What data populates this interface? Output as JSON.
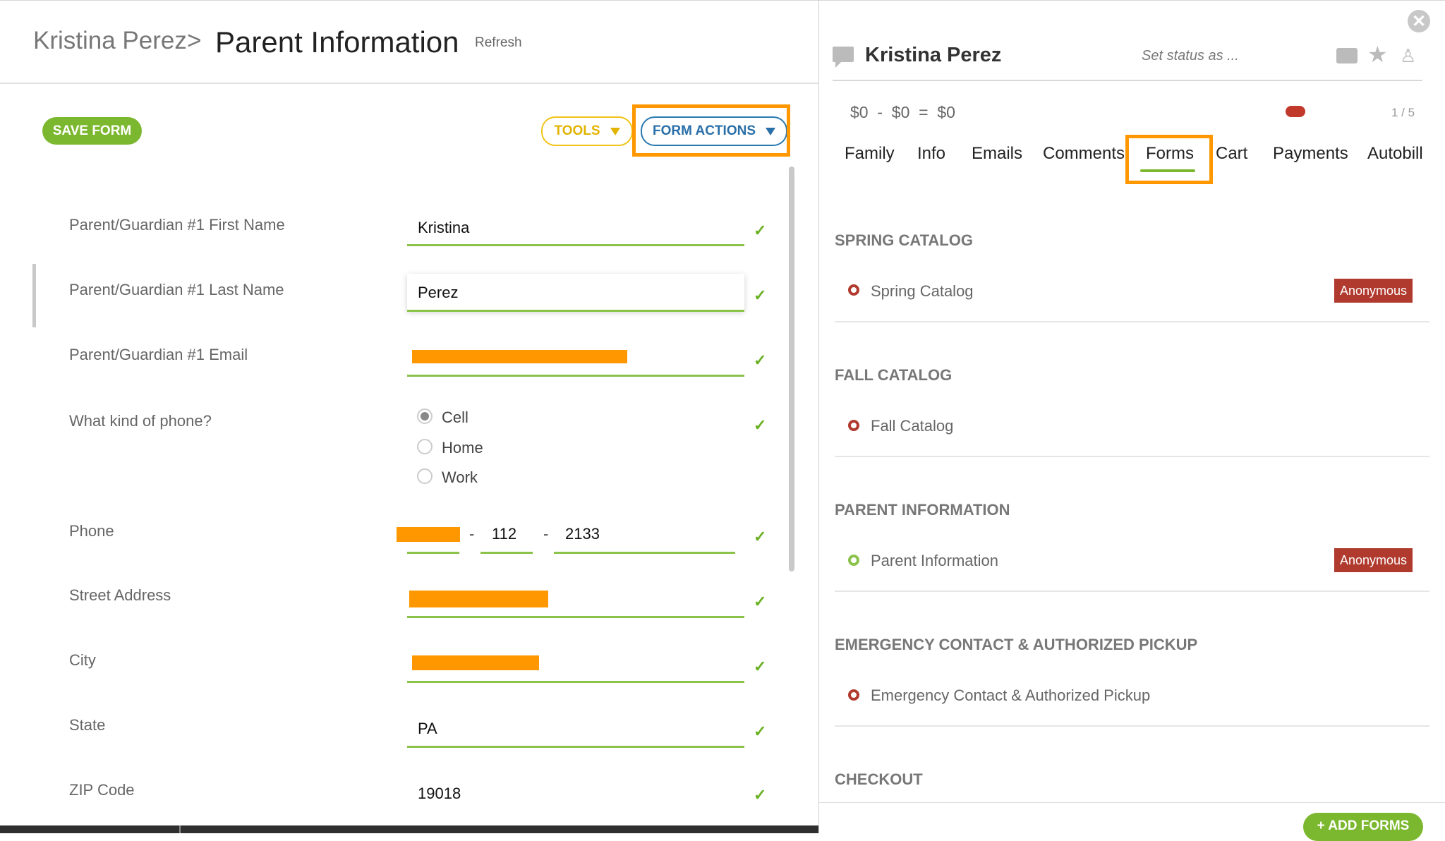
{
  "header": {
    "breadcrumb_parent": "Kristina Perez",
    "breadcrumb_separator": ">",
    "page_title": "Parent Information",
    "refresh_label": "Refresh"
  },
  "toolbar": {
    "save_label": "SAVE FORM",
    "tools_label": "TOOLS",
    "form_actions_label": "FORM ACTIONS"
  },
  "form": {
    "first_name_label": "Parent/Guardian #1 First Name",
    "first_name_value": "Kristina",
    "last_name_label": "Parent/Guardian #1 Last Name",
    "last_name_value": "Perez",
    "email_label": "Parent/Guardian #1 Email",
    "phone_kind_label": "What kind of phone?",
    "phone_kind_options": [
      "Cell",
      "Home",
      "Work"
    ],
    "phone_kind_selected": "Cell",
    "phone_label": "Phone",
    "phone_part2": "112",
    "phone_part3": "2133",
    "phone_dash": "-",
    "street_label": "Street Address",
    "city_label": "City",
    "state_label": "State",
    "state_value": "PA",
    "zip_label": "ZIP Code",
    "zip_value": "19018",
    "check_glyph": "✓"
  },
  "profile": {
    "name": "Kristina Perez",
    "status_placeholder": "Set status as ...",
    "balance": "$0  -  $0  =  $0",
    "pager": "1 / 5",
    "close_glyph": "✕",
    "star_glyph": "★",
    "person_glyph": "♙",
    "tabs": [
      "Family",
      "Info",
      "Emails",
      "Comments",
      "Forms",
      "Cart",
      "Payments",
      "Autobill"
    ],
    "active_tab": "Forms"
  },
  "forms_list": {
    "sections": [
      {
        "title": "SPRING CATALOG",
        "item": "Spring Catalog",
        "status": "red",
        "badge": "Anonymous"
      },
      {
        "title": "FALL CATALOG",
        "item": "Fall Catalog",
        "status": "red",
        "badge": ""
      },
      {
        "title": "PARENT INFORMATION",
        "item": "Parent Information",
        "status": "green",
        "badge": "Anonymous"
      },
      {
        "title": "EMERGENCY CONTACT & AUTHORIZED PICKUP",
        "item": "Emergency Contact & Authorized Pickup",
        "status": "red",
        "badge": ""
      },
      {
        "title": "CHECKOUT",
        "item": "",
        "status": "",
        "badge": ""
      }
    ],
    "add_forms_label": "+ ADD FORMS"
  },
  "colors": {
    "accent_green": "#7cb82f",
    "accent_blue": "#2a6fa8",
    "accent_yellow": "#e2b300",
    "highlight_orange": "#ff9800",
    "badge_red": "#b03a2e"
  }
}
